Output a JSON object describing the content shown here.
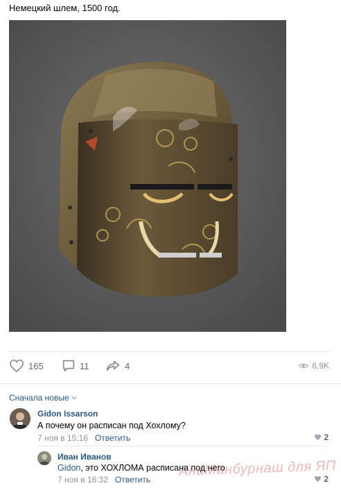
{
  "post": {
    "text": "Немецкий шлем, 1500 год.",
    "image_alt": "German painted great helm on grey background"
  },
  "actions": {
    "likes": "165",
    "comments": "11",
    "shares": "4",
    "views": "6.9K"
  },
  "comments_section": {
    "sort_label": "Сначала новые"
  },
  "comments": [
    {
      "author": "Gidon Issarson",
      "text": "А почему он расписан под Хохлому?",
      "date": "7 ноя в 15:16",
      "reply_label": "Ответить",
      "likes": "2"
    },
    {
      "author": "Иван Иванов",
      "mention": "Gidon",
      "text": ", это ХОХЛОМА расписана под него",
      "date": "7 ноя в 16:32",
      "reply_label": "Ответить",
      "likes": "2"
    }
  ],
  "watermark": "АнаМанбурнаш для ЯП",
  "colors": {
    "link": "#2a5885",
    "muted": "#939393",
    "divider": "#e7e8ec"
  }
}
